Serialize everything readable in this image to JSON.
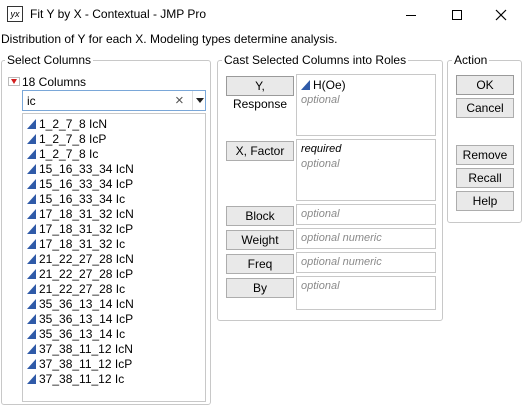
{
  "window": {
    "icon_text": "yx",
    "title": "Fit Y by X - Contextual - JMP Pro",
    "minimize_icon": "minimize-icon",
    "maximize_icon": "maximize-icon",
    "close_icon": "close-icon"
  },
  "description": "Distribution of Y for each X. Modeling types determine analysis.",
  "select_columns": {
    "label": "Select Columns",
    "count_label": "18 Columns",
    "search_value": "ic",
    "columns": [
      "1_2_7_8 IcN",
      "1_2_7_8 IcP",
      "1_2_7_8 Ic",
      "15_16_33_34 IcN",
      "15_16_33_34 IcP",
      "15_16_33_34 Ic",
      "17_18_31_32 IcN",
      "17_18_31_32 IcP",
      "17_18_31_32 Ic",
      "21_22_27_28 IcN",
      "21_22_27_28 IcP",
      "21_22_27_28 Ic",
      "35_36_13_14 IcN",
      "35_36_13_14 IcP",
      "35_36_13_14 Ic",
      "37_38_11_12 IcN",
      "37_38_11_12 IcP",
      "37_38_11_12 Ic"
    ]
  },
  "cast_columns": {
    "label": "Cast Selected Columns into Roles",
    "y_button": "Y, Response",
    "y_value": "H(Oe)",
    "y_hint": "optional",
    "x_button": "X, Factor",
    "x_required": "required",
    "x_hint": "optional",
    "block_button": "Block",
    "block_hint": "optional",
    "weight_button": "Weight",
    "weight_hint": "optional numeric",
    "freq_button": "Freq",
    "freq_hint": "optional numeric",
    "by_button": "By",
    "by_hint": "optional"
  },
  "action": {
    "label": "Action",
    "ok": "OK",
    "cancel": "Cancel",
    "remove": "Remove",
    "recall": "Recall",
    "help": "Help"
  }
}
